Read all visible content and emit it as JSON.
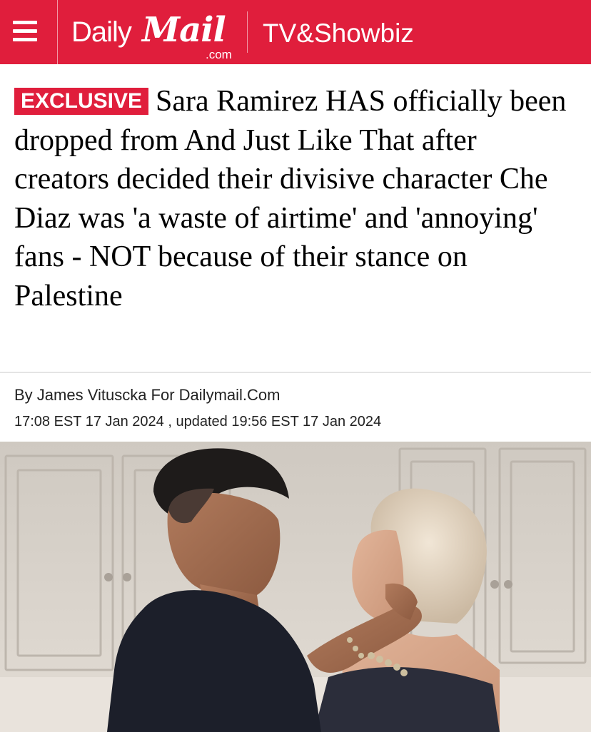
{
  "header": {
    "brand_daily": "Daily",
    "brand_mail": "Mail",
    "brand_com": ".com",
    "section": "TV&Showbiz",
    "menu_icon": "hamburger-menu-icon",
    "bar_color": "#e01e3c"
  },
  "article": {
    "badge": "EXCLUSIVE",
    "headline": "Sara Ramirez HAS officially been dropped from And Just Like That after creators decided their divisive character Che Diaz was 'a waste of airtime' and 'annoying' fans - NOT because of their stance on Palestine",
    "byline": "By James Vituscka For Dailymail.Com",
    "timestamp": "17:08 EST 17 Jan 2024 , updated 19:56 EST 17 Jan 2024"
  }
}
